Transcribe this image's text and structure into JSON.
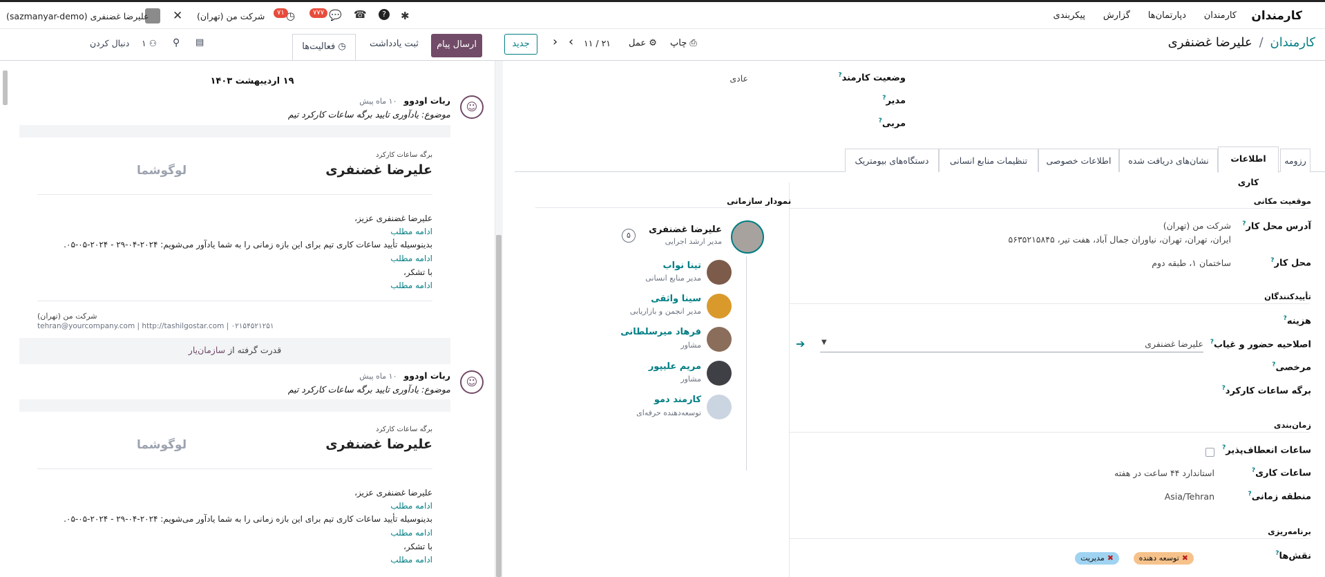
{
  "app": {
    "name": "کارمندان"
  },
  "topnav": {
    "items": [
      "کارمندان",
      "دپارتمان‌ها",
      "گزارش",
      "پیکربندی"
    ]
  },
  "systray": {
    "company": "شرکت من (تهران)",
    "user": "علیرضا غضنفری (sazmanyar-demo)",
    "messages_badge": "۷۷۷",
    "activity_badge": "۷۱"
  },
  "breadcrumb": {
    "parent": "کارمندان",
    "separator": "/",
    "current": "علیرضا غضنفری"
  },
  "controls": {
    "print": "چاپ",
    "action": "عمل",
    "pager": "۱۱ / ۲۱",
    "new": "جدید"
  },
  "chatter": {
    "send_message": "ارسال پیام",
    "log_note": "ثبت یادداشت",
    "activities": "فعالیت‌ها",
    "followers_count": "۱",
    "follow": "دنبال کردن",
    "date_separator": "۱۹ اردیبهشت ۱۴۰۳",
    "messages": [
      {
        "author": "ربات اودوو",
        "time": "۱۰ ماه پیش",
        "subject": "موضوع: یادآوری تایید برگه ساعات کارکرد تیم",
        "card_caption": "برگه ساعات کارکرد",
        "card_name": "علیرضا غضنفری",
        "logo": "لوگوشما",
        "greeting": "علیرضا غضنفری عزیز،",
        "read_more": "ادامه مطلب",
        "body": "بدینوسیله تأیید ساعات کاری تیم برای این بازه زمانی را به شما یادآور می‌شویم: ۲۰۲۴-۰۴-۲۹ - ۲۰۲۴-۰۵-۰۵.",
        "thanks": "با تشکر،",
        "company": "شرکت من (تهران)",
        "footer": "tehran@yourcompany.com | http://tashilgostar.com | ۰۲۱۵۴۵۲۱۲۵۱",
        "powered": "قدرت گرفته از",
        "powered_link": "سازمان‌یار"
      },
      {
        "author": "ربات اودوو",
        "time": "۱۰ ماه پیش",
        "subject": "موضوع: یادآوری تایید برگه ساعات کارکرد تیم",
        "card_caption": "برگه ساعات کارکرد",
        "card_name": "علیرضا غضنفری",
        "logo": "لوگوشما",
        "greeting": "علیرضا غضنفری عزیز،",
        "read_more": "ادامه مطلب",
        "body": "بدینوسیله تأیید ساعات کاری تیم برای این بازه زمانی را به شما یادآور می‌شویم: ۲۰۲۴-۰۴-۲۹ - ۲۰۲۴-۰۵-۰۵.",
        "thanks": "با تشکر،"
      }
    ]
  },
  "form": {
    "employee_status_label": "وضعیت کارمند",
    "employee_status_value": "عادی",
    "manager_label": "مدیر",
    "coach_label": "مربی",
    "tabs": [
      "رزومه",
      "اطلاعات کاری",
      "نشان‌های دریافت شده",
      "اطلاعات خصوصی",
      "تنظیمات منابع انسانی",
      "دستگاه‌های بیومتریک"
    ],
    "location_section": "موقعیت مکانی",
    "work_address_label": "آدرس محل کار",
    "work_address_company": "شرکت من (تهران)",
    "work_address_line": "ایران، تهران، تهران، نیاوران جمال آباد، هفت تیر، ۵۶۳۵۲۱۵۸۴۵",
    "work_location_label": "محل کار",
    "work_location_value": "ساختمان ۱، طبقه دوم",
    "approvers_section": "تأییدکنندگان",
    "expense_label": "هزینه",
    "attendance_label": "اصلاحیه حضور و غیاب",
    "attendance_value": "علیرضا غضنفری",
    "timeoff_label": "مرخصی",
    "timesheet_label": "برگه ساعات کارکرد",
    "schedule_section": "زمان‌بندی",
    "flex_label": "ساعات انعطاف‌پذیر",
    "hours_label": "ساعات کاری",
    "hours_value": "استاندارد ۴۴ ساعت در هفته",
    "tz_label": "منطقه زمانی",
    "tz_value": "Asia/Tehran",
    "planning_section": "برنامه‌ریزی",
    "roles_label": "نقش‌ها",
    "roles": [
      {
        "name": "توسعه دهنده",
        "color": "#f6c28b"
      },
      {
        "name": "مدیریت",
        "color": "#9fd3f1"
      }
    ]
  },
  "org_chart": {
    "title": "نمودار سازمانی",
    "self": {
      "name": "علیرضا غضنفری",
      "job": "مدیر ارشد اجرایی",
      "count": "۵"
    },
    "members": [
      {
        "name": "تینا نواب",
        "job": "مدیر منابع انسانی"
      },
      {
        "name": "سینا واثقی",
        "job": "مدیر انجمن و بازاریابی"
      },
      {
        "name": "فرهاد میرسلطانی",
        "job": "مشاور"
      },
      {
        "name": "مریم علیپور",
        "job": "مشاور"
      },
      {
        "name": "کارمند دمو",
        "job": "توسعه‌دهنده حرفه‌ای"
      }
    ]
  },
  "colors": {
    "accent": "#017e84",
    "primary": "#714b67",
    "badge": "#e74c3c"
  }
}
